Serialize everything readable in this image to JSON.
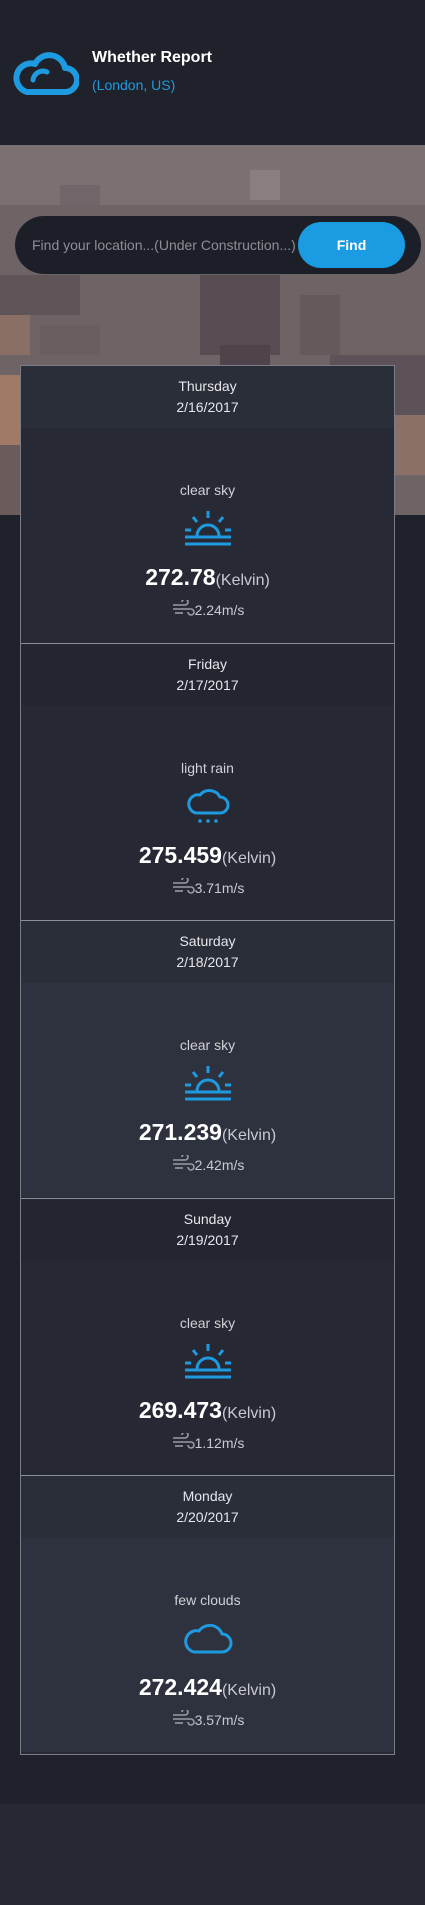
{
  "header": {
    "title": "Whether Report",
    "location": "(London, US)",
    "logo_icon": "cloud-icon"
  },
  "search": {
    "placeholder": "Find your location...(Under Construction...)",
    "button_label": "Find"
  },
  "colors": {
    "accent": "#1a9be2",
    "background": "#1f212b",
    "card": "#2e313e"
  },
  "temp_unit": "(Kelvin)",
  "forecast": [
    {
      "day": "Thursday",
      "date": "2/16/2017",
      "condition": "clear sky",
      "icon": "sunrise-icon",
      "temp": "272.78",
      "wind": "2.24m/s"
    },
    {
      "day": "Friday",
      "date": "2/17/2017",
      "condition": "light rain",
      "icon": "rain-cloud-icon",
      "temp": "275.459",
      "wind": "3.71m/s"
    },
    {
      "day": "Saturday",
      "date": "2/18/2017",
      "condition": "clear sky",
      "icon": "sunrise-icon",
      "temp": "271.239",
      "wind": "2.42m/s"
    },
    {
      "day": "Sunday",
      "date": "2/19/2017",
      "condition": "clear sky",
      "icon": "sunrise-icon",
      "temp": "269.473",
      "wind": "1.12m/s"
    },
    {
      "day": "Monday",
      "date": "2/20/2017",
      "condition": "few clouds",
      "icon": "cloud-icon",
      "temp": "272.424",
      "wind": "3.57m/s"
    }
  ]
}
